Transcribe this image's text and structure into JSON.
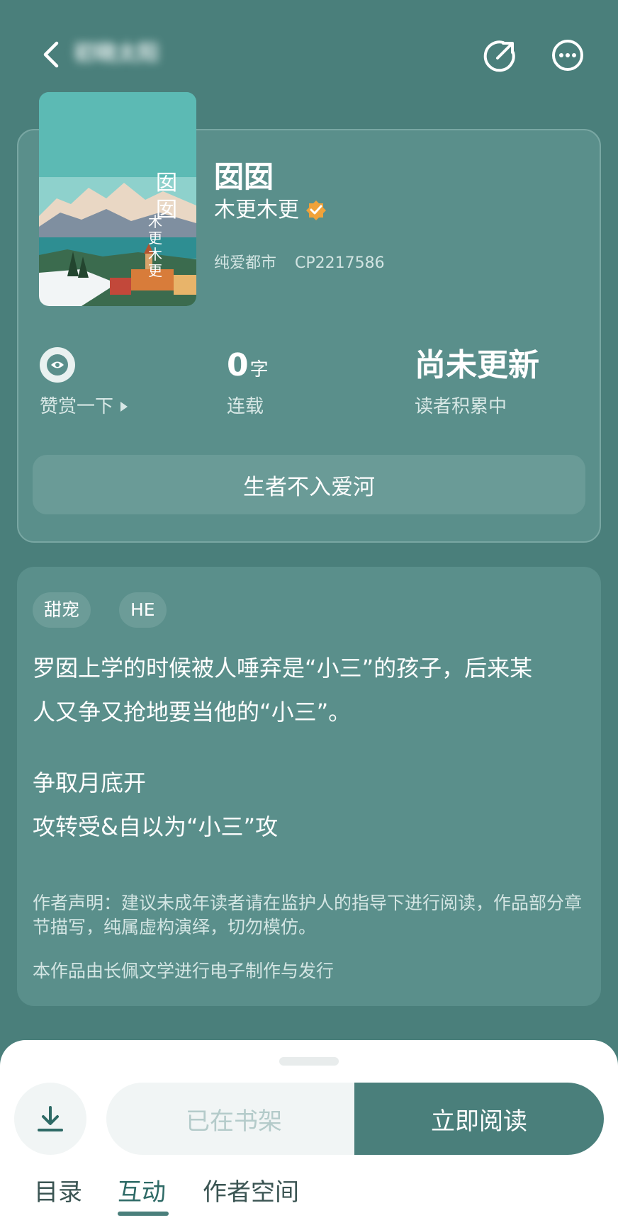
{
  "header": {
    "blurred_title": "初晓太阳"
  },
  "book": {
    "cover_title": "囡囡",
    "cover_author": "木更木更",
    "title": "囡囡",
    "author": "木更木更",
    "category": "纯爱都市",
    "cp_id": "CP2217586"
  },
  "stats": {
    "reward_label": "赞赏一下",
    "word_count": "0",
    "word_unit": "字",
    "serial_label": "连载",
    "update_status": "尚未更新",
    "update_sub": "读者积累中"
  },
  "slogan": "生者不入爱河",
  "tags": [
    "甜宠",
    "HE"
  ],
  "description": {
    "line1": "罗囡上学的时候被人唾弃是“小三”的孩子，后来某",
    "line2": "人又争又抢地要当他的“小三”。",
    "line3": "争取月底开",
    "line4": "攻转受&自以为“小三”攻",
    "disclaimer": "作者声明：建议未成年读者请在监护人的指导下进行阅读，作品部分章节描写，纯属虚构演绎，切勿模仿。",
    "publisher": "本作品由长佩文学进行电子制作与发行"
  },
  "actions": {
    "on_shelf": "已在书架",
    "read_now": "立即阅读"
  },
  "tabs": {
    "toc": "目录",
    "interact": "互动",
    "author_space": "作者空间"
  },
  "colors": {
    "background": "#4a7f7b",
    "card": "#5a8f8b",
    "accent": "#4a7f7b",
    "verified_badge": "#f0a23a"
  }
}
